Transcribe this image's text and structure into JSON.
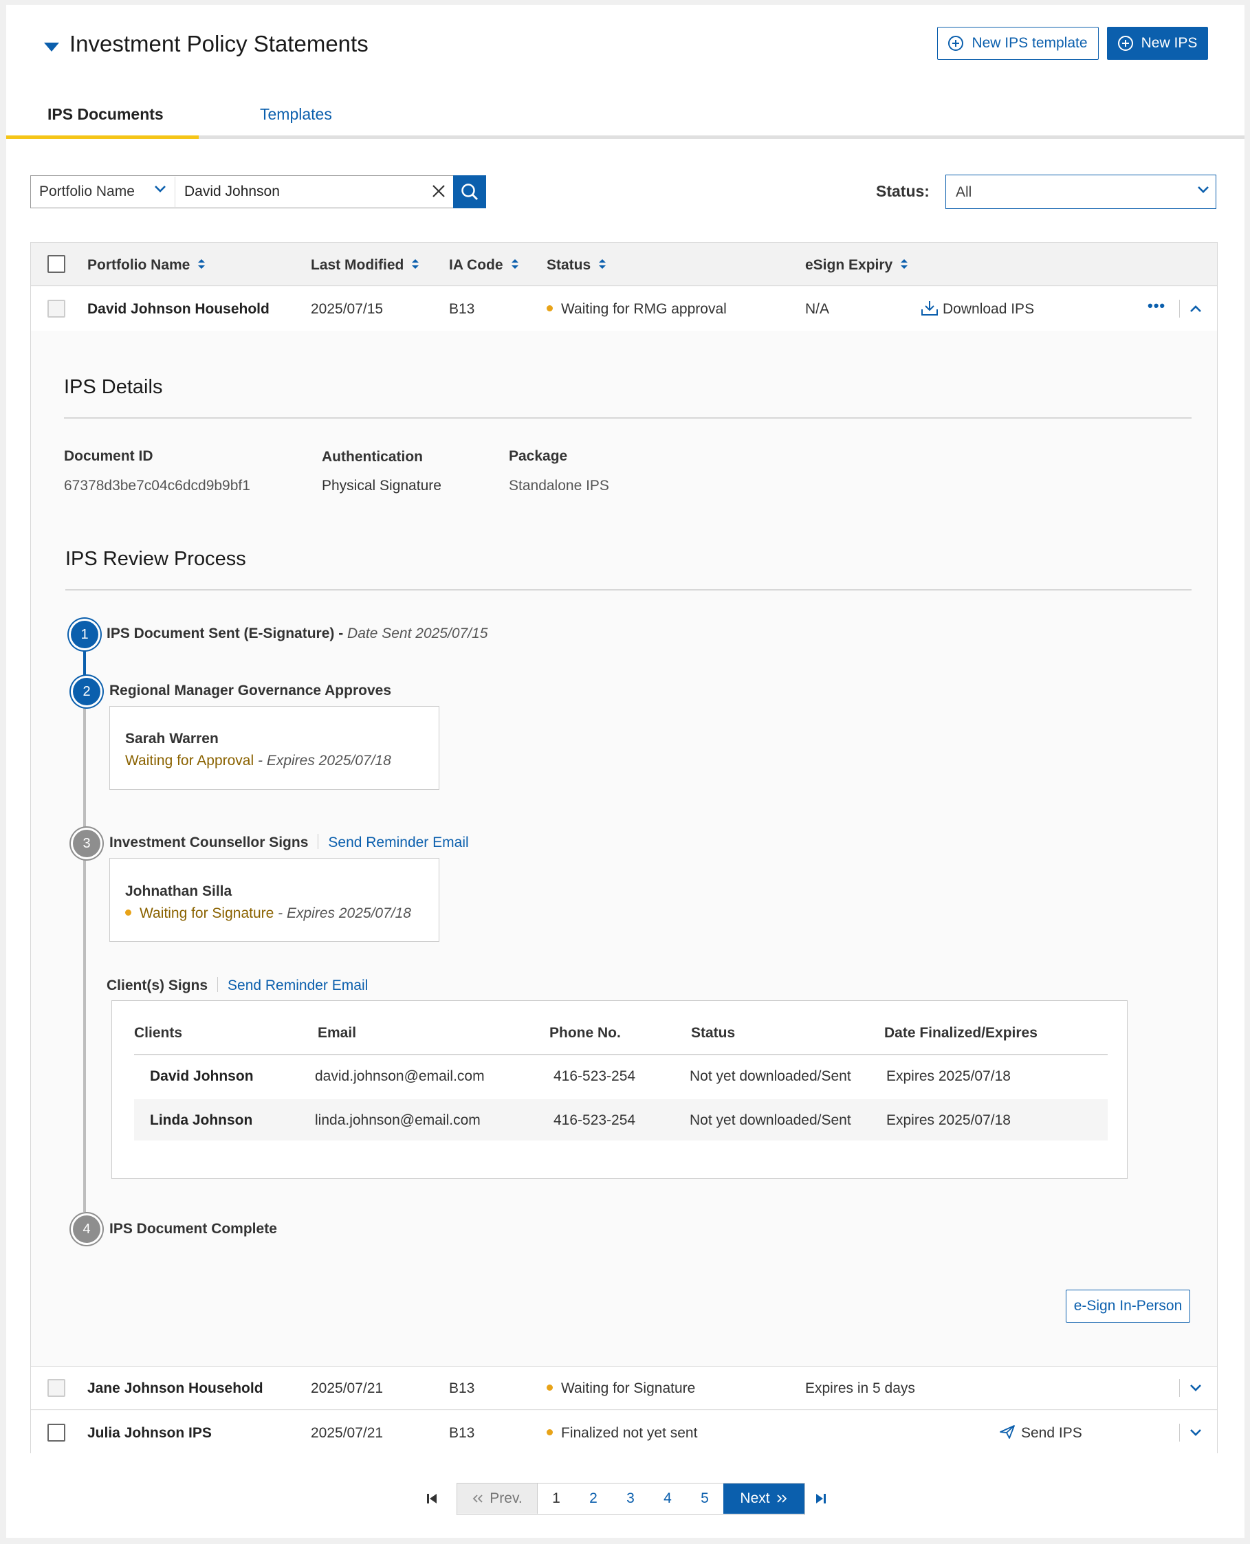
{
  "header": {
    "title": "Investment Policy Statements",
    "new_template_label": "New IPS template",
    "new_ips_label": "New IPS"
  },
  "tabs": [
    {
      "label": "IPS Documents",
      "active": true
    },
    {
      "label": "Templates",
      "active": false
    }
  ],
  "filter": {
    "field": "Portfolio Name",
    "value": "David Johnson",
    "status_label": "Status:",
    "status_value": "All"
  },
  "table": {
    "columns": [
      "Portfolio Name",
      "Last Modified",
      "IA Code",
      "Status",
      "eSign Expiry"
    ],
    "rows": [
      {
        "name": "David Johnson Household",
        "modified": "2025/07/15",
        "ia_code": "B13",
        "status": "Waiting for RMG approval",
        "expiry": "N/A",
        "action": "Download IPS"
      },
      {
        "name": "Jane Johnson Household",
        "modified": "2025/07/21",
        "ia_code": "B13",
        "status": "Waiting for Signature",
        "expiry": "Expires in 5 days",
        "action": ""
      },
      {
        "name": "Julia Johnson IPS",
        "modified": "2025/07/21",
        "ia_code": "B13",
        "status": "Finalized not yet sent",
        "expiry": "",
        "action": "Send IPS"
      }
    ]
  },
  "details": {
    "title": "IPS Details",
    "doc_id_label": "Document ID",
    "doc_id": "67378d3be7c04c6dcd9b9bf1",
    "auth_label": "Authentication",
    "auth": "Physical Signature",
    "package_label": "Package",
    "package": "Standalone IPS"
  },
  "review": {
    "title": "IPS Review Process",
    "step1": {
      "num": "1",
      "title": "IPS Document Sent (E-Signature) -",
      "date": "Date Sent 2025/07/15"
    },
    "step2": {
      "num": "2",
      "title": "Regional Manager Governance Approves",
      "person": "Sarah Warren",
      "status": "Waiting for Approval",
      "expires": "- Expires 2025/07/18"
    },
    "step3": {
      "num": "3",
      "title": "Investment Counsellor Signs",
      "reminder": "Send Reminder Email",
      "person": "Johnathan Silla",
      "status": "Waiting for Signature",
      "expires": "- Expires 2025/07/18"
    },
    "clients": {
      "title": "Client(s) Signs",
      "reminder": "Send Reminder Email",
      "columns": [
        "Clients",
        "Email",
        "Phone No.",
        "Status",
        "Date Finalized/Expires"
      ],
      "rows": [
        {
          "name": "David Johnson",
          "email": "david.johnson@email.com",
          "phone": "416-523-254",
          "status": "Not yet downloaded/Sent",
          "date": "Expires 2025/07/18"
        },
        {
          "name": "Linda Johnson",
          "email": "linda.johnson@email.com",
          "phone": "416-523-254",
          "status": "Not yet downloaded/Sent",
          "date": "Expires 2025/07/18"
        }
      ]
    },
    "step4": {
      "num": "4",
      "title": "IPS Document Complete"
    },
    "esign_label": "e-Sign In-Person"
  },
  "pagination": {
    "prev": "Prev.",
    "pages": [
      "1",
      "2",
      "3",
      "4",
      "5"
    ],
    "next": "Next"
  },
  "colors": {
    "accent": "#0b5fad",
    "tab_indicator": "#f5c518",
    "status_warn": "#e8a318",
    "status_text": "#8a6200"
  }
}
